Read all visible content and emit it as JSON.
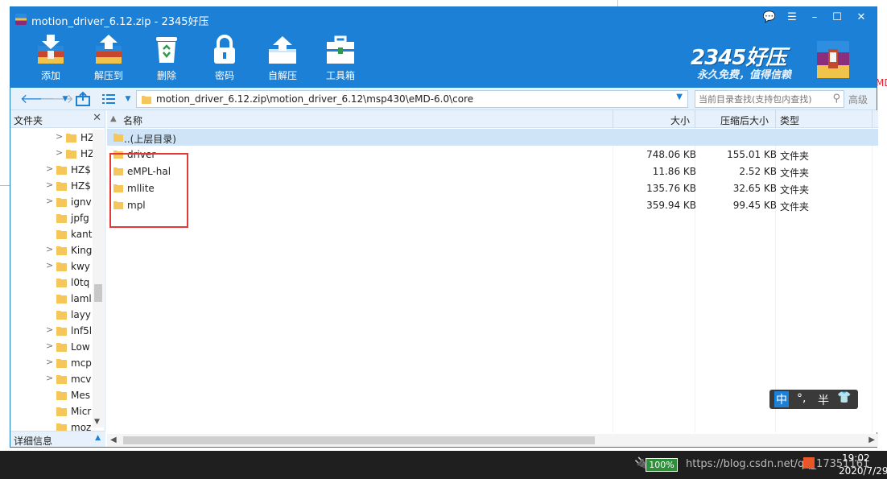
{
  "window": {
    "title": "motion_driver_6.12.zip - 2345好压",
    "controls": [
      "💬",
      "☰",
      "–",
      "☐",
      "✕"
    ]
  },
  "toolbar": {
    "buttons": [
      {
        "label": "添加",
        "icon": "add-icon"
      },
      {
        "label": "解压到",
        "icon": "extract-to-icon"
      },
      {
        "label": "删除",
        "icon": "delete-icon"
      },
      {
        "label": "密码",
        "icon": "lock-icon"
      },
      {
        "label": "自解压",
        "icon": "self-extract-icon"
      },
      {
        "label": "工具箱",
        "icon": "toolbox-icon"
      }
    ]
  },
  "brand": {
    "name": "2345好压",
    "slogan": "永久免费，值得信赖"
  },
  "address": {
    "path": "motion_driver_6.12.zip\\motion_driver_6.12\\msp430\\eMD-6.0\\core",
    "search_placeholder": "当前目录查找(支持包内查找)",
    "advanced_label": "高级"
  },
  "sidebar": {
    "title": "文件夹",
    "items": [
      {
        "label": "HZ",
        "arrow": ">"
      },
      {
        "label": "HZ",
        "arrow": ">"
      },
      {
        "label": "HZ$",
        "arrow": ">"
      },
      {
        "label": "HZ$",
        "arrow": ">"
      },
      {
        "label": "ignv",
        "arrow": ">"
      },
      {
        "label": "jpfg",
        "arrow": ""
      },
      {
        "label": "kant",
        "arrow": ""
      },
      {
        "label": "King",
        "arrow": ">"
      },
      {
        "label": "kwy",
        "arrow": ">"
      },
      {
        "label": "l0tq",
        "arrow": ""
      },
      {
        "label": "laml",
        "arrow": ""
      },
      {
        "label": "layy",
        "arrow": ""
      },
      {
        "label": "lnf5l",
        "arrow": ">"
      },
      {
        "label": "Low",
        "arrow": ">"
      },
      {
        "label": "mcp",
        "arrow": ">"
      },
      {
        "label": "mcv",
        "arrow": ">"
      },
      {
        "label": "Mes",
        "arrow": ""
      },
      {
        "label": "Micr",
        "arrow": ""
      },
      {
        "label": "moz",
        "arrow": ""
      }
    ],
    "details_label": "详细信息"
  },
  "filelist": {
    "columns": {
      "name": "名称",
      "size": "大小",
      "compressed": "压缩后大小",
      "type": "类型"
    },
    "parent_label": "..(上层目录)",
    "rows": [
      {
        "name": "driver",
        "size": "748.06 KB",
        "compressed": "155.01 KB",
        "type": "文件夹"
      },
      {
        "name": "eMPL-hal",
        "size": "11.86 KB",
        "compressed": "2.52 KB",
        "type": "文件夹"
      },
      {
        "name": "mllite",
        "size": "135.76 KB",
        "compressed": "32.65 KB",
        "type": "文件夹"
      },
      {
        "name": "mpl",
        "size": "359.94 KB",
        "compressed": "99.45 KB",
        "type": "文件夹"
      }
    ]
  },
  "ime": {
    "mode": "中",
    "punct": "°,",
    "width": "半"
  },
  "taskbar": {
    "battery": "100%",
    "watermark": "https://blog.csdn.net/qq_17351161",
    "time": "19:02",
    "date": "2020/7/29"
  },
  "desktop": {
    "fragment": "MD"
  },
  "colors": {
    "accent": "#1b80d6",
    "highlight": "#e53935",
    "folder": "#f5c75a"
  }
}
